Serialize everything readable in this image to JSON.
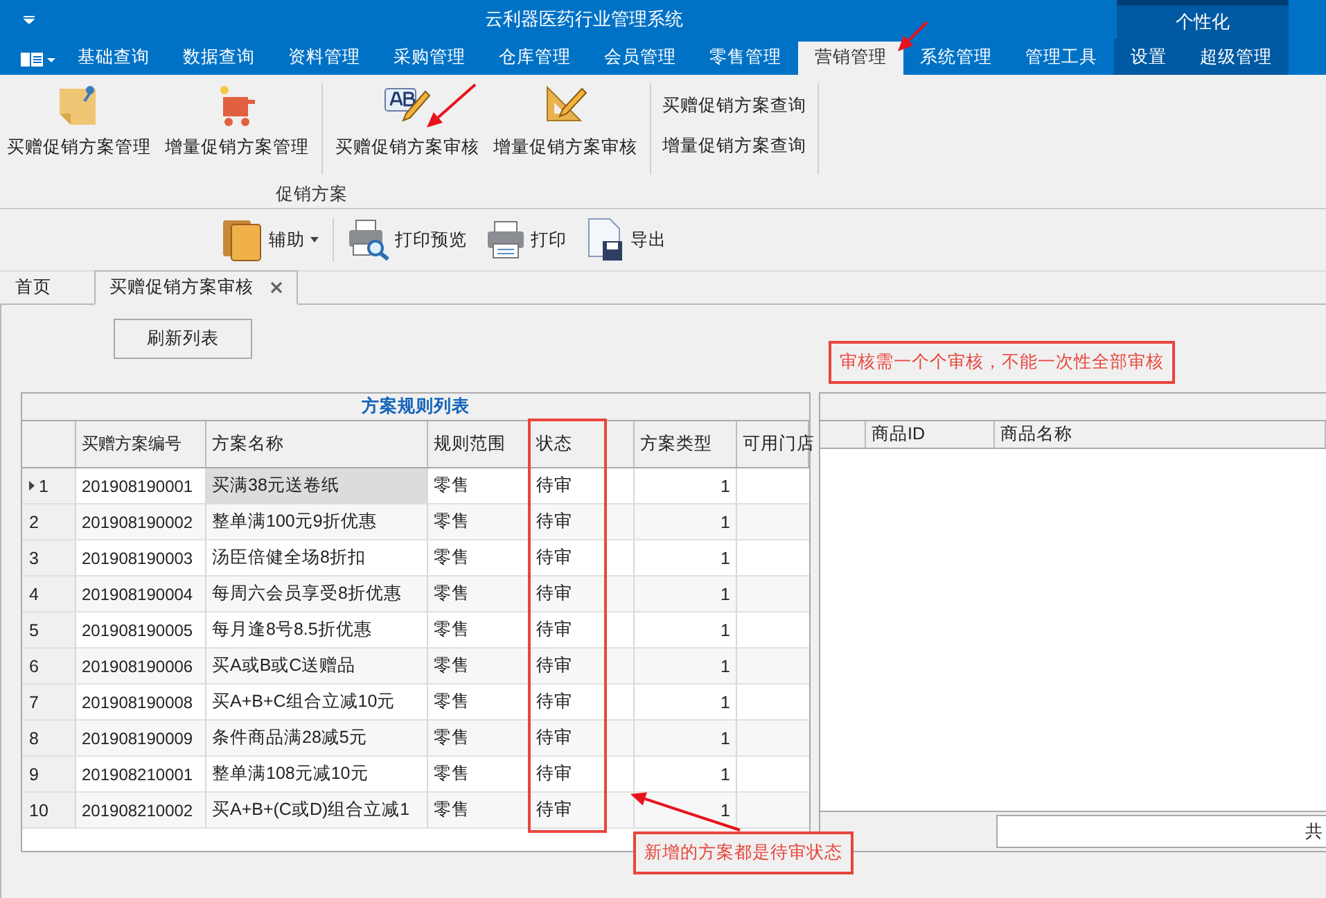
{
  "window": {
    "title": "云利器医药行业管理系统"
  },
  "menu_tabs": [
    {
      "label": "基础查询",
      "selected": false
    },
    {
      "label": "数据查询",
      "selected": false
    },
    {
      "label": "资料管理",
      "selected": false
    },
    {
      "label": "采购管理",
      "selected": false
    },
    {
      "label": "仓库管理",
      "selected": false
    },
    {
      "label": "会员管理",
      "selected": false
    },
    {
      "label": "零售管理",
      "selected": false
    },
    {
      "label": "营销管理",
      "selected": true
    },
    {
      "label": "系统管理",
      "selected": false
    },
    {
      "label": "管理工具",
      "selected": false
    }
  ],
  "personalize": {
    "title": "个性化",
    "tabs": [
      {
        "label": "设置",
        "selected": false
      },
      {
        "label": "超级管理",
        "selected": false
      }
    ]
  },
  "ribbon": {
    "group_label": "促销方案",
    "large_buttons": [
      {
        "label": "买赠促销方案管理",
        "kind": "note"
      },
      {
        "label": "增量促销方案管理",
        "kind": "cart"
      },
      {
        "label": "买赠促销方案审核",
        "kind": "ab"
      },
      {
        "label": "增量促销方案审核",
        "kind": "ruler"
      }
    ],
    "small_buttons": [
      {
        "label": "买赠促销方案查询"
      },
      {
        "label": "增量促销方案查询"
      }
    ]
  },
  "toolbar": [
    {
      "label": "辅助",
      "kind": "books",
      "dropdown": true
    },
    {
      "label": "打印预览",
      "kind": "preview",
      "dropdown": false
    },
    {
      "label": "打印",
      "kind": "printer",
      "dropdown": false
    },
    {
      "label": "导出",
      "kind": "export",
      "dropdown": false
    }
  ],
  "doc_tabs": [
    {
      "label": "首页",
      "selected": false,
      "closable": false
    },
    {
      "label": "买赠促销方案审核",
      "selected": true,
      "closable": true
    }
  ],
  "refresh_button": "刷新列表",
  "table": {
    "title": "方案规则列表",
    "columns": [
      "买赠方案编号",
      "方案名称",
      "规则范围",
      "状态",
      "方案类型",
      "可用门店"
    ],
    "rows": [
      {
        "index": "1",
        "code": "201908190001",
        "name": "买满38元送卷纸",
        "scope": "零售",
        "status": "待审",
        "type": "1",
        "selected": true
      },
      {
        "index": "2",
        "code": "201908190002",
        "name": "整单满100元9折优惠",
        "scope": "零售",
        "status": "待审",
        "type": "1",
        "selected": false
      },
      {
        "index": "3",
        "code": "201908190003",
        "name": "汤臣倍健全场8折扣",
        "scope": "零售",
        "status": "待审",
        "type": "1",
        "selected": false
      },
      {
        "index": "4",
        "code": "201908190004",
        "name": "每周六会员享受8折优惠",
        "scope": "零售",
        "status": "待审",
        "type": "1",
        "selected": false
      },
      {
        "index": "5",
        "code": "201908190005",
        "name": "每月逢8号8.5折优惠",
        "scope": "零售",
        "status": "待审",
        "type": "1",
        "selected": false
      },
      {
        "index": "6",
        "code": "201908190006",
        "name": "买A或B或C送赠品",
        "scope": "零售",
        "status": "待审",
        "type": "1",
        "selected": false
      },
      {
        "index": "7",
        "code": "201908190008",
        "name": "买A+B+C组合立减10元",
        "scope": "零售",
        "status": "待审",
        "type": "1",
        "selected": false
      },
      {
        "index": "8",
        "code": "201908190009",
        "name": "条件商品满28减5元",
        "scope": "零售",
        "status": "待审",
        "type": "1",
        "selected": false
      },
      {
        "index": "9",
        "code": "201908210001",
        "name": "整单满108元减10元",
        "scope": "零售",
        "status": "待审",
        "type": "1",
        "selected": false
      },
      {
        "index": "10",
        "code": "201908210002",
        "name": "买A+B+(C或D)组合立减1",
        "scope": "零售",
        "status": "待审",
        "type": "1",
        "selected": false
      }
    ]
  },
  "detail_table": {
    "columns": [
      "商品ID",
      "商品名称"
    ],
    "footer": "共"
  },
  "annotations": [
    {
      "text": "审核需一个个审核，不能一次性全部审核"
    },
    {
      "text": "新增的方案都是待审状态"
    }
  ]
}
